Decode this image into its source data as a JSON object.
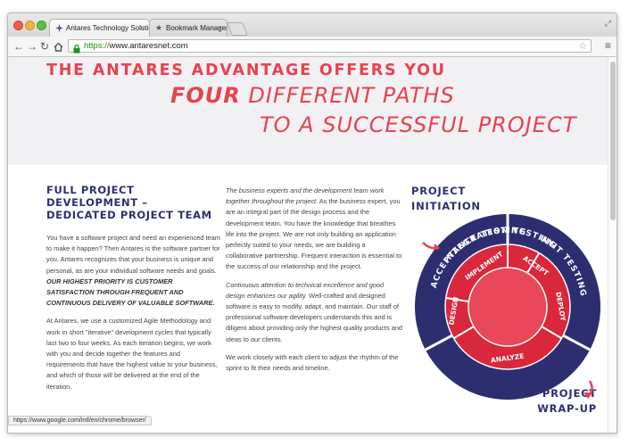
{
  "browser": {
    "tabs": [
      {
        "label": "Antares Technology Solutio",
        "icon": "antares-favicon"
      },
      {
        "label": "Bookmark Manager",
        "icon": "star-icon"
      }
    ],
    "url_scheme": "https://",
    "url_rest": "www.antaresnet.com",
    "status_url": "https://www.google.com/intl/en/chrome/browser/"
  },
  "hero": {
    "line1": "THE ANTARES ADVANTAGE OFFERS YOU",
    "line2_bold": "FOUR",
    "line2_rest": " DIFFERENT PATHS",
    "line3": "TO A SUCCESSFUL PROJECT",
    "color": "#e8424f"
  },
  "left": {
    "title": "FULL PROJECT DEVELOPMENT – DEDICATED PROJECT TEAM",
    "p1": "You have a software project and need an experienced team to make it happen? Then Antares is the software partner for you. Antares recognizes that your business is unique and personal, as are your individual software needs and goals.",
    "p1_strong": "OUR HIGHEST PRIORITY IS CUSTOMER SATISFACTION THROUGH FREQUENT AND CONTINUOUS DELIVERY OF VALUABLE SOFTWARE.",
    "p2": "At Antares, we use a customized Agile Methodology and work in short \"iterative\" development cycles that typically last two to four weeks. As each iteration begins, we work with you and decide together the features and requirements that have the highest value to your business, and which of those will be delivered at the end of the iteration."
  },
  "middle": {
    "p1_em": "The business experts and the development team work together throughout the project.",
    "p1": " As the business expert, you are an integral part of the design process and the development team. You have the knowledge that breathes life into the project. We are not only building an application perfectly suited to your needs, we are building a collaborative partnership. Frequent interaction is essential to the success of our relationship and the project.",
    "p2_em": "Continuous attention to technical excellence and good design enhances our agility.",
    "p2": " Well-crafted and designed software is easy to modify, adapt, and maintain. Our staff of professional software developers understands this and is diligent about providing only the highest quality products and ideas to our clients.",
    "p3": "We work closely with each client to adjust the rhythm of the sprint to fit their needs and timeline."
  },
  "diagram": {
    "label_start": "PROJECT INITIATION",
    "label_end": "PROJECT WRAP-UP",
    "outer_labels": [
      "ACCEPTANCE TESTING",
      "UNIT TESTING",
      "INTEGRATION TESTING"
    ],
    "inner_labels": [
      "IMPLEMENT",
      "ACCEPT",
      "DEPLOY",
      "ANALYZE",
      "DESIGN"
    ],
    "colors": {
      "navy": "#2d2e6f",
      "red": "#d9283b",
      "pink": "#e9475a"
    }
  }
}
